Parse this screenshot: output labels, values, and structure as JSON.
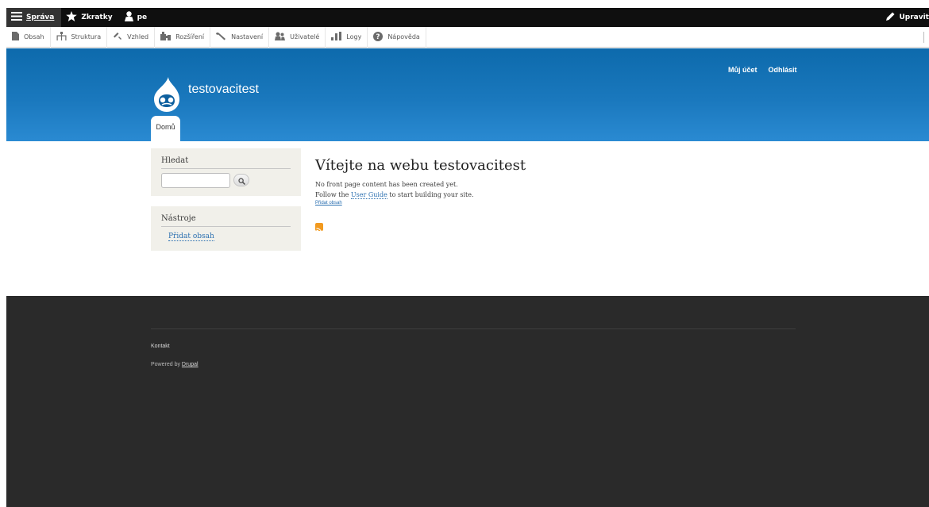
{
  "toolbar": {
    "items": [
      {
        "label": "Správa",
        "icon": "hamburger-icon"
      },
      {
        "label": "Zkratky",
        "icon": "star-icon"
      },
      {
        "label": "pe",
        "icon": "user-icon"
      }
    ],
    "edit_label": "Upravit"
  },
  "tray": {
    "items": [
      {
        "label": "Obsah",
        "icon": "file-icon"
      },
      {
        "label": "Struktura",
        "icon": "sitemap-icon"
      },
      {
        "label": "Vzhled",
        "icon": "paintbrush-icon"
      },
      {
        "label": "Rozšíření",
        "icon": "puzzle-icon"
      },
      {
        "label": "Nastavení",
        "icon": "wrench-icon"
      },
      {
        "label": "Uživatelé",
        "icon": "users-icon"
      },
      {
        "label": "Logy",
        "icon": "bar-chart-icon"
      },
      {
        "label": "Nápověda",
        "icon": "help-icon"
      }
    ]
  },
  "header": {
    "secondary_menu": [
      "Můj účet",
      "Odhlásit"
    ],
    "site_name": "testovacitest",
    "main_tab": "Domů"
  },
  "sidebar": {
    "search": {
      "title": "Hledat",
      "placeholder": ""
    },
    "tools": {
      "title": "Nástroje",
      "link": "Přidat obsah"
    }
  },
  "main": {
    "title": "Vítejte na webu testovacitest",
    "line1": "No front page content has been created yet.",
    "line2_prefix": "Follow the ",
    "line2_link": "User Guide",
    "line2_suffix": " to start building your site.",
    "add_content": "Přidat obsah"
  },
  "footer": {
    "contact": "Kontakt",
    "powered_prefix": "Powered by ",
    "powered_link": "Drupal"
  },
  "colors": {
    "toolbar_bg": "#0f0f0f",
    "header_blue": "#1a78bd",
    "link": "#2a6fb0",
    "footer_bg": "#2a2a2a",
    "rss": "#f29a1f"
  }
}
